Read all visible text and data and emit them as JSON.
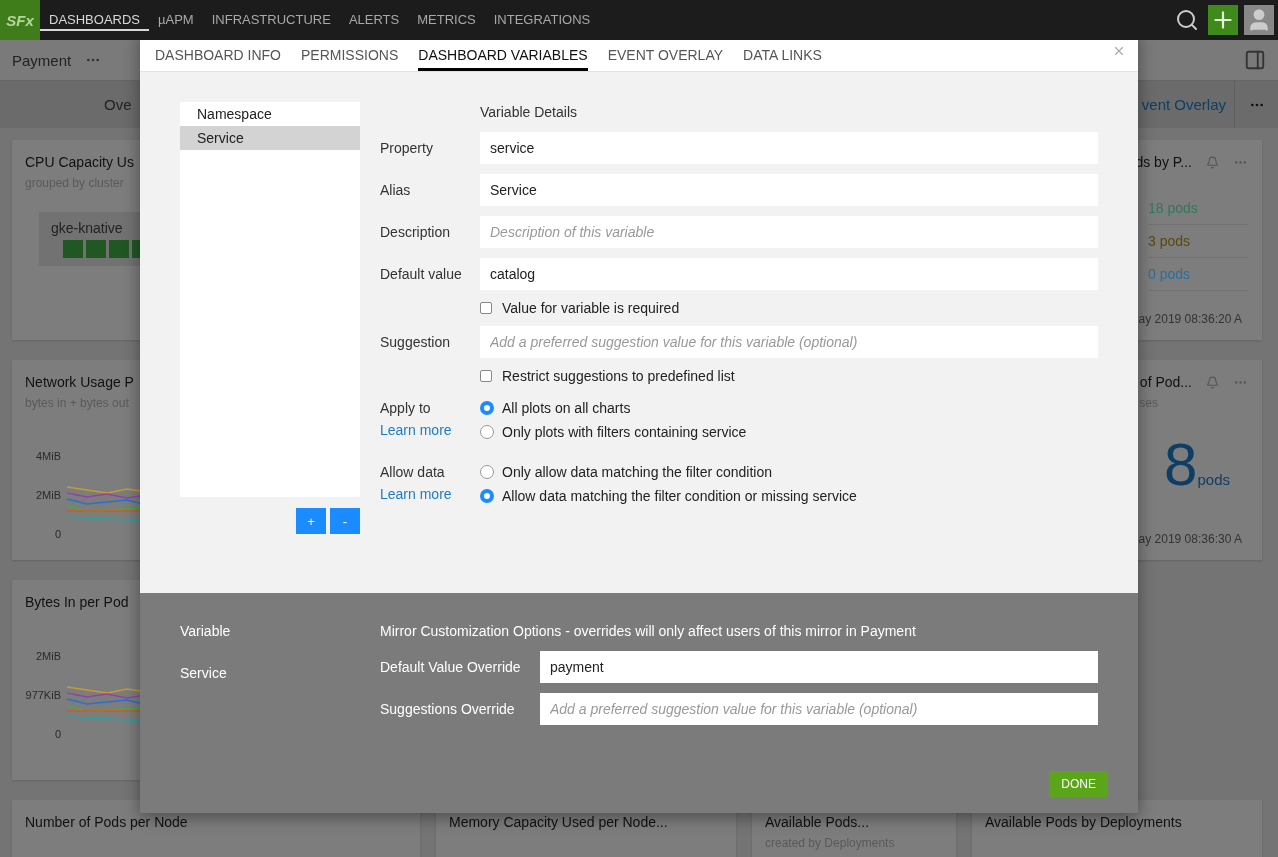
{
  "nav": {
    "logo": "SFx",
    "items": [
      {
        "label": "DASHBOARDS",
        "selected": true
      },
      {
        "label": "µAPM",
        "selected": false
      },
      {
        "label": "INFRASTRUCTURE",
        "selected": false
      },
      {
        "label": "ALERTS",
        "selected": false
      },
      {
        "label": "METRICS",
        "selected": false
      },
      {
        "label": "INTEGRATIONS",
        "selected": false
      }
    ]
  },
  "header": {
    "title": "Payment"
  },
  "dashboard_tabs": {
    "left": "Ove",
    "right": "vent Overlay"
  },
  "left_cards": [
    {
      "kind": "heatmap",
      "title": "CPU Capacity Us",
      "subtitle": "grouped by cluster",
      "group": "gke-knative"
    },
    {
      "kind": "lines",
      "title": "Network Usage P",
      "subtitle": "bytes in + bytes out",
      "y_ticks": [
        "4MiB",
        "2MiB",
        "0"
      ]
    },
    {
      "kind": "lines",
      "title": "Bytes In per Pod",
      "y_ticks": [
        "2MiB",
        "977KiB",
        "0"
      ]
    }
  ],
  "right_cards": [
    {
      "kind": "list",
      "title": "ds by P...",
      "rows": [
        {
          "text": "18 pods",
          "color": "#2f7a59"
        },
        {
          "text": "3 pods",
          "color": "#5a4a08"
        },
        {
          "text": "0 pods",
          "color": "#2a6f9e"
        }
      ],
      "footer": "ay 2019 08:36:20 A"
    },
    {
      "kind": "number",
      "title": "of Pod...",
      "subtitle": "ses",
      "value": "8",
      "unit": "pods",
      "footer": "ay 2019 08:36:30 A"
    }
  ],
  "bottom_cards": [
    {
      "title": "Number of Pods per Node"
    },
    {
      "title": "Memory Capacity Used per Node..."
    },
    {
      "title": "Available Pods...",
      "subtitle": "created by Deployments"
    },
    {
      "title": "Available Pods by Deployments"
    }
  ],
  "modal": {
    "tabs": [
      {
        "label": "DASHBOARD INFO",
        "selected": false
      },
      {
        "label": "PERMISSIONS",
        "selected": false
      },
      {
        "label": "DASHBOARD VARIABLES",
        "selected": true
      },
      {
        "label": "EVENT OVERLAY",
        "selected": false
      },
      {
        "label": "DATA LINKS",
        "selected": false
      }
    ],
    "variables": [
      {
        "name": "Namespace",
        "selected": false
      },
      {
        "name": "Service",
        "selected": true
      }
    ],
    "add_button": "+",
    "remove_button": "-",
    "details_title": "Variable Details",
    "fields": [
      {
        "label": "Property",
        "value": "service"
      },
      {
        "label": "Alias",
        "value": "Service"
      },
      {
        "label": "Description",
        "placeholder": "Description of this variable"
      },
      {
        "label": "Default value",
        "value": "catalog"
      }
    ],
    "required": {
      "label": "Value for variable is required",
      "checked": false
    },
    "suggestion": {
      "label": "Suggestion",
      "placeholder": "Add a preferred suggestion value for this variable (optional)"
    },
    "restrict": {
      "label": "Restrict suggestions to predefined list",
      "checked": false
    },
    "radio_groups": [
      {
        "label": "Apply to",
        "link": "Learn more",
        "options": [
          {
            "label": "All plots on all charts",
            "selected": true
          },
          {
            "label": "Only plots with filters containing service",
            "selected": false
          }
        ]
      },
      {
        "label": "Allow data",
        "link": "Learn more",
        "options": [
          {
            "label": "Only allow data matching the filter condition",
            "selected": false
          },
          {
            "label": "Allow data matching the filter condition or missing service",
            "selected": true
          }
        ]
      }
    ],
    "mirror": {
      "column_label": "Variable",
      "heading": "Mirror Customization Options - overrides will only affect users of this mirror in Payment",
      "variable": "Service",
      "fields": [
        {
          "label": "Default Value Override",
          "value": "payment"
        },
        {
          "label": "Suggestions Override",
          "placeholder": "Add a preferred suggestion value for this variable (optional)"
        }
      ]
    },
    "done_button": "DONE"
  }
}
